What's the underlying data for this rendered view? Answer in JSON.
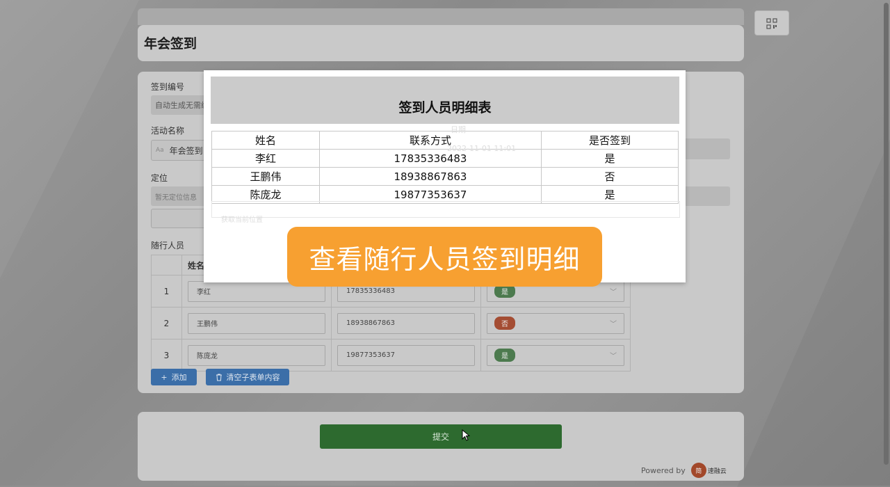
{
  "page_title": "年会签到",
  "form": {
    "sign_no_label": "签到编号",
    "sign_no_placeholder": "自动生成无需编号",
    "activity_label": "活动名称",
    "activity_value": "年会签到",
    "activity_prefix": "Aa",
    "location_label": "定位",
    "location_placeholder": "暂无定位信息",
    "location_button": "获取当前位置",
    "date_label": "日期",
    "date_value": "2022-11-01 11:01",
    "companions_label": "随行人员",
    "col_name": "姓名",
    "rows": [
      {
        "index": "1",
        "name": "李红",
        "phone": "17835336483",
        "signed": "是"
      },
      {
        "index": "2",
        "name": "王鹏伟",
        "phone": "18938867863",
        "signed": "否"
      },
      {
        "index": "3",
        "name": "陈庞龙",
        "phone": "19877353637",
        "signed": "是"
      }
    ],
    "add_button": "添加",
    "clear_button": "清空子表单内容"
  },
  "submit_label": "提交",
  "powered_by": "Powered by",
  "brand_logo_text": "简",
  "brand_name": "速融云",
  "modal": {
    "title": "签到人员明细表",
    "headers": [
      "姓名",
      "联系方式",
      "是否签到"
    ],
    "rows": [
      [
        "李红",
        "17835336483",
        "是"
      ],
      [
        "王鹏伟",
        "18938867863",
        "否"
      ],
      [
        "陈庞龙",
        "19877353637",
        "是"
      ]
    ]
  },
  "banner_text": "查看随行人员签到明细",
  "colors": {
    "banner": "#f7a031",
    "submit": "#2d6a2f",
    "primary_button": "#3b6ea8",
    "tag_yes": "#4c7a4e",
    "tag_no": "#a44d33"
  }
}
